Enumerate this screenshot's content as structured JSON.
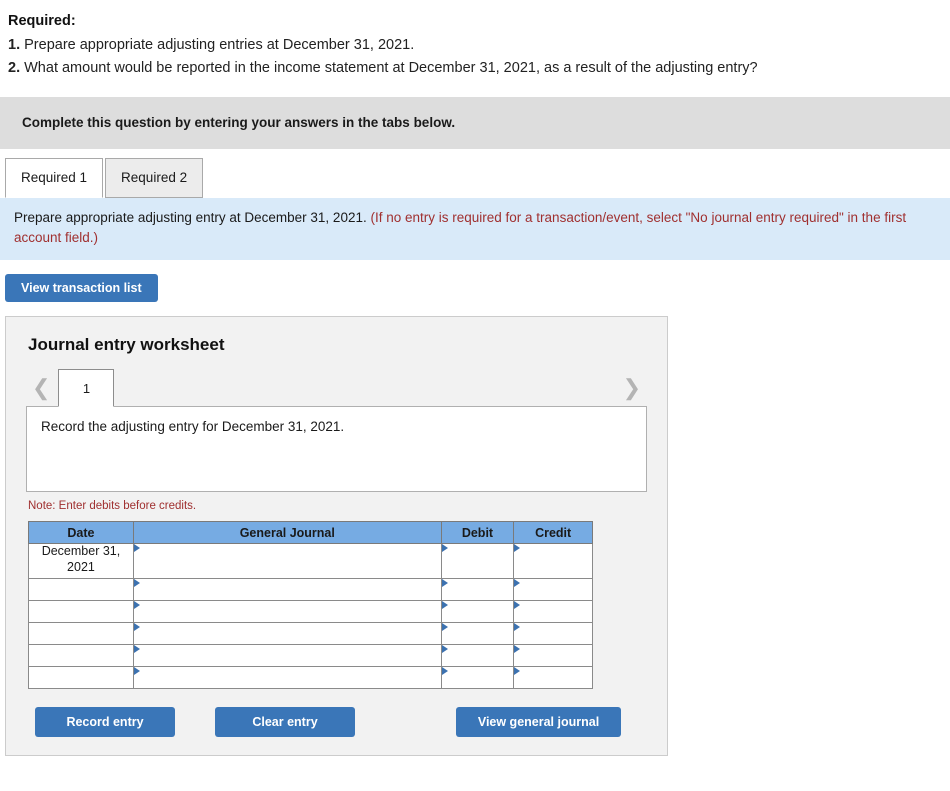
{
  "required": {
    "heading": "Required:",
    "items": [
      {
        "num": "1.",
        "text": "Prepare appropriate adjusting entries at December 31, 2021."
      },
      {
        "num": "2.",
        "text": "What amount would be reported in the income statement at December 31, 2021, as a result of the adjusting entry?"
      }
    ]
  },
  "banner": {
    "text": "Complete this question by entering your answers in the tabs below."
  },
  "tabs": [
    {
      "label": "Required 1",
      "active": true
    },
    {
      "label": "Required 2",
      "active": false
    }
  ],
  "instruction": {
    "black": "Prepare appropriate adjusting entry at December 31, 2021.",
    "red": "(If no entry is required for a transaction/event, select \"No journal entry required\" in the first account field.)"
  },
  "toolbar": {
    "view_transaction_list": "View transaction list"
  },
  "worksheet": {
    "title": "Journal entry worksheet",
    "pager": {
      "prev_icon": "chevron-left",
      "next_icon": "chevron-right",
      "entries": [
        "1"
      ],
      "active_entry": "1"
    },
    "record_prompt": "Record the adjusting entry for December 31, 2021.",
    "note": "Note: Enter debits before credits.",
    "table": {
      "columns": [
        "Date",
        "General Journal",
        "Debit",
        "Credit"
      ],
      "rows": [
        {
          "date": "December 31, 2021",
          "general_journal": "",
          "debit": "",
          "credit": "",
          "tall": true
        },
        {
          "date": "",
          "general_journal": "",
          "debit": "",
          "credit": "",
          "tall": false
        },
        {
          "date": "",
          "general_journal": "",
          "debit": "",
          "credit": "",
          "tall": false
        },
        {
          "date": "",
          "general_journal": "",
          "debit": "",
          "credit": "",
          "tall": false
        },
        {
          "date": "",
          "general_journal": "",
          "debit": "",
          "credit": "",
          "tall": false
        },
        {
          "date": "",
          "general_journal": "",
          "debit": "",
          "credit": "",
          "tall": false
        }
      ]
    },
    "actions": {
      "record_entry": "Record entry",
      "clear_entry": "Clear entry",
      "view_general_journal": "View general journal"
    }
  },
  "colors": {
    "button_blue": "#3a76b8",
    "table_header_blue": "#76abe3",
    "cell_border_blue": "#5b8fc6",
    "instruction_bg": "#d9eaf9",
    "banner_gray": "#dddddd",
    "panel_gray": "#f2f2f2",
    "red_text": "#a03030"
  }
}
